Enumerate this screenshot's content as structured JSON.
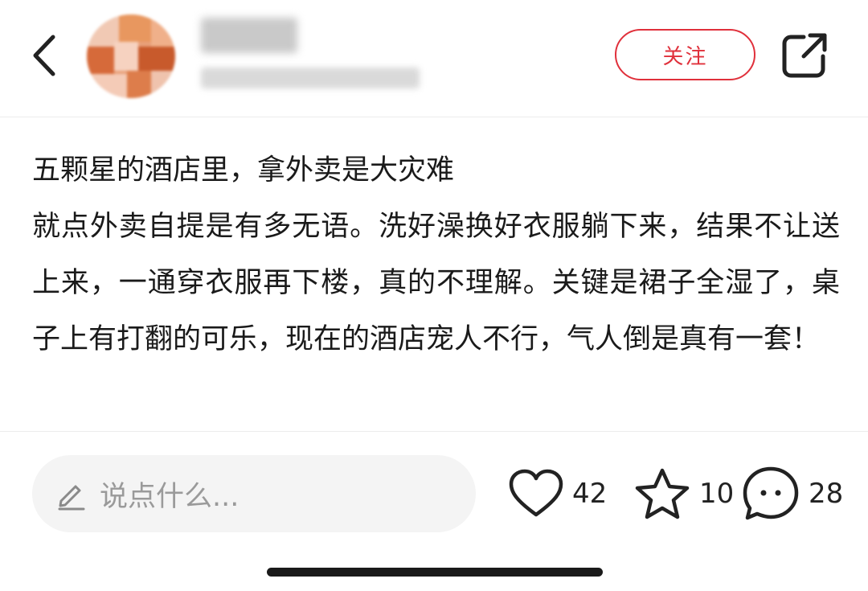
{
  "header": {
    "follow_label": "关注"
  },
  "post": {
    "title": "五颗星的酒店里，拿外卖是大灾难",
    "body": "就点外卖自提是有多无语。洗好澡换好衣服躺下来，结果不让送上来，一通穿衣服再下楼，真的不理解。关键是裙子全湿了，桌子上有打翻的可乐，现在的酒店宠人不行，气人倒是真有一套！"
  },
  "footer": {
    "comment_placeholder": "说点什么...",
    "likes": "42",
    "favorites": "10",
    "comments": "28"
  },
  "colors": {
    "accent": "#e0303b",
    "text": "#1a1a1a",
    "placeholder": "#9a9a9a",
    "input_bg": "#f4f4f4"
  },
  "icons": {
    "back": "chevron-left-icon",
    "share": "share-icon",
    "pencil": "pencil-icon",
    "like": "heart-icon",
    "favorite": "star-icon",
    "comment": "comment-bubble-icon"
  }
}
